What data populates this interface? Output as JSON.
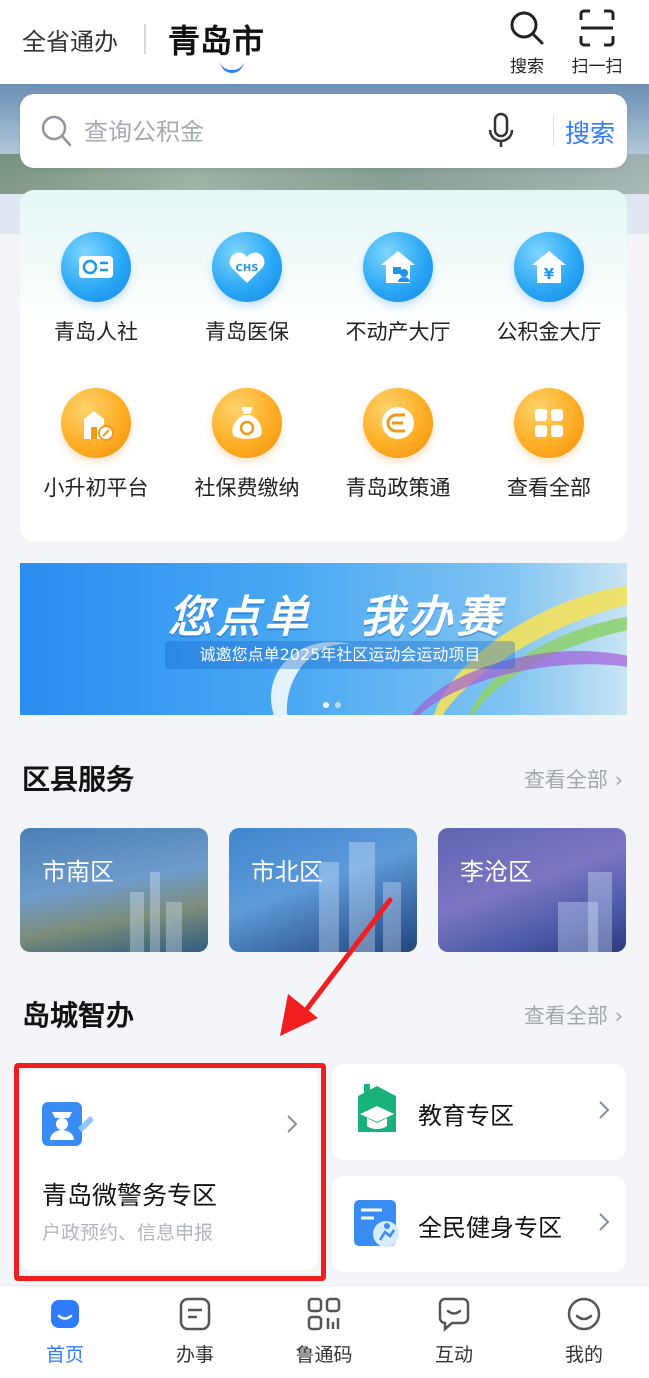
{
  "header": {
    "province_label": "全省通办",
    "city_label": "青岛市",
    "search_action": "搜索",
    "scan_action": "扫一扫"
  },
  "search": {
    "placeholder": "查询公积金",
    "button_label": "搜索"
  },
  "services": [
    {
      "label": "青岛人社",
      "icon": "social-security-card-icon",
      "color": "blue"
    },
    {
      "label": "青岛医保",
      "icon": "medical-insurance-heart-icon",
      "color": "blue"
    },
    {
      "label": "不动产大厅",
      "icon": "real-estate-house-icon",
      "color": "blue"
    },
    {
      "label": "公积金大厅",
      "icon": "housing-fund-yen-icon",
      "color": "blue"
    },
    {
      "label": "小升初平台",
      "icon": "school-building-icon",
      "color": "orange"
    },
    {
      "label": "社保费缴纳",
      "icon": "money-bag-icon",
      "color": "orange"
    },
    {
      "label": "青岛政策通",
      "icon": "policy-coin-icon",
      "color": "orange"
    },
    {
      "label": "查看全部",
      "icon": "all-apps-grid-icon",
      "color": "orange"
    }
  ],
  "banner": {
    "title": "您点单　我办赛",
    "subtitle": "诚邀您点单2025年社区运动会运动项目"
  },
  "district_section": {
    "title": "区县服务",
    "more": "查看全部",
    "items": [
      "市南区",
      "市北区",
      "李沧区"
    ]
  },
  "smart_section": {
    "title": "岛城智办",
    "more": "查看全部",
    "police": {
      "title": "青岛微警务专区",
      "subtitle": "户政预约、信息申报"
    },
    "education": "教育专区",
    "fitness": "全民健身专区"
  },
  "nav": {
    "home": "首页",
    "affairs": "办事",
    "code": "鲁通码",
    "interact": "互动",
    "mine": "我的"
  },
  "colors": {
    "accent": "#2f7bff",
    "highlight_red": "#f01e1e",
    "service_blue": "#2ba8f5",
    "service_orange": "#ffae25"
  }
}
